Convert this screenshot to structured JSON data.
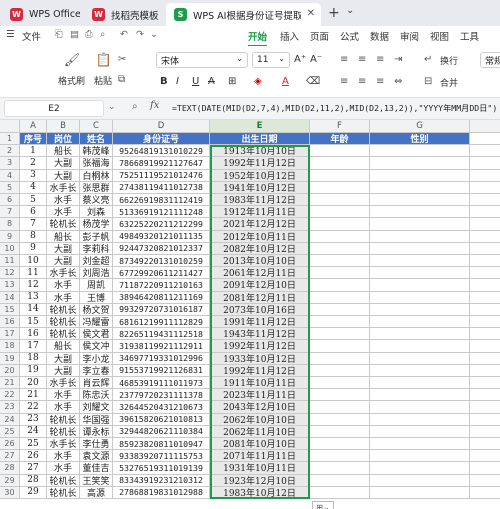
{
  "tabs": [
    {
      "label": "WPS Office",
      "icon": "W"
    },
    {
      "label": "找稻壳模板",
      "icon": "W"
    },
    {
      "label": "WPS AI根据身份证号提取出生日期",
      "icon": "S"
    }
  ],
  "menu": {
    "file_label": "文件",
    "items": [
      "开始",
      "插入",
      "页面",
      "公式",
      "数据",
      "审阅",
      "视图",
      "工具"
    ]
  },
  "ribbon": {
    "format_painter": "格式刷",
    "paste": "粘贴",
    "font_name": "宋体",
    "font_size": "11",
    "wrap": "换行",
    "merge": "合并",
    "number_format": "常规"
  },
  "formula_bar": {
    "cell_ref": "E2",
    "fx": "fx",
    "formula": "=TEXT(DATE(MID(D2,7,4),MID(D2,11,2),MID(D2,13,2)),\"YYYY年MM月DD日\")"
  },
  "sheet": {
    "col_headers": [
      "A",
      "B",
      "C",
      "D",
      "E",
      "F",
      "G"
    ],
    "header_row": [
      "序号",
      "岗位",
      "姓名",
      "身份证号",
      "出生日期",
      "年龄",
      "性别"
    ],
    "rows": [
      [
        "1",
        "船长",
        "韩茂峰",
        "95264819131010229",
        "1913年10月10日"
      ],
      [
        "2",
        "大副",
        "张福海",
        "78668919921127647",
        "1992年11月12日"
      ],
      [
        "3",
        "大副",
        "白桐林",
        "75251119521012476",
        "1952年10月12日"
      ],
      [
        "4",
        "水手长",
        "张思群",
        "27438119411012738",
        "1941年10月12日"
      ],
      [
        "5",
        "水手",
        "蔡义亮",
        "66226919831112419",
        "1983年11月12日"
      ],
      [
        "6",
        "水手",
        "刘森",
        "51336919121111248",
        "1912年11月11日"
      ],
      [
        "7",
        "轮机长",
        "杨茂学",
        "63225220211212299",
        "2021年12月12日"
      ],
      [
        "8",
        "船长",
        "彭子帆",
        "49849320121011135",
        "2012年10月11日"
      ],
      [
        "9",
        "大副",
        "李莉科",
        "92447320821012337",
        "2082年10月12日"
      ],
      [
        "10",
        "大副",
        "刘金超",
        "87349220131010259",
        "2013年10月10日"
      ],
      [
        "11",
        "水手长",
        "刘周浩",
        "67729920611211427",
        "2061年12月11日"
      ],
      [
        "12",
        "水手",
        "周凯",
        "71187220911210163",
        "2091年12月10日"
      ],
      [
        "13",
        "水手",
        "王博",
        "38946420811211169",
        "2081年12月11日"
      ],
      [
        "14",
        "轮机长",
        "杨文贺",
        "99329720731016187",
        "2073年10月16日"
      ],
      [
        "15",
        "轮机长",
        "冯耀雷",
        "68161219911112829",
        "1991年11月12日"
      ],
      [
        "16",
        "轮机长",
        "侯文君",
        "82265119431112518",
        "1943年11月12日"
      ],
      [
        "17",
        "船长",
        "侯文冲",
        "31938119921112911",
        "1992年11月12日"
      ],
      [
        "18",
        "大副",
        "李小龙",
        "34697719331012996",
        "1933年10月12日"
      ],
      [
        "19",
        "大副",
        "李立春",
        "91553719921126831",
        "1992年11月12日"
      ],
      [
        "20",
        "水手长",
        "肖云辉",
        "46853919111011973",
        "1911年10月11日"
      ],
      [
        "21",
        "水手",
        "陈忠沃",
        "23779720231111378",
        "2023年11月11日"
      ],
      [
        "22",
        "水手",
        "刘耀文",
        "32644520431210673",
        "2043年12月10日"
      ],
      [
        "23",
        "轮机长",
        "华国强",
        "39615820621010813",
        "2062年10月10日"
      ],
      [
        "24",
        "轮机长",
        "谭永标",
        "32944820621110384",
        "2062年11月10日"
      ],
      [
        "25",
        "水手长",
        "李仕勇",
        "85923820811010947",
        "2081年10月10日"
      ],
      [
        "26",
        "水手",
        "袁文源",
        "93383920711115753",
        "2071年11月11日"
      ],
      [
        "27",
        "水手",
        "董佳吉",
        "53276519311019139",
        "1931年10月11日"
      ],
      [
        "28",
        "轮机长",
        "王笑笑",
        "83343919231210312",
        "1923年12月10日"
      ],
      [
        "29",
        "轮机长",
        "高源",
        "27868819831012988",
        "1983年10月12日"
      ]
    ]
  }
}
